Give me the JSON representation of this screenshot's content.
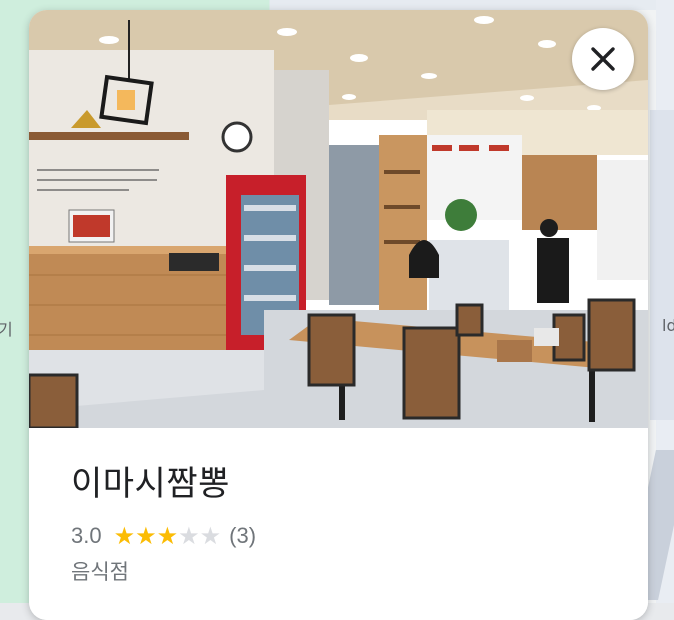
{
  "map": {
    "label_left": "기",
    "label_right": "ld"
  },
  "place": {
    "name": "이마시짬뽕",
    "rating": "3.0",
    "stars_filled": 3,
    "stars_total": 5,
    "review_count": "(3)",
    "category": "음식점",
    "photo_icon": "restaurant-interior-photo"
  },
  "close_button": {
    "icon": "close-icon"
  },
  "colors": {
    "star_filled": "#fbbc04",
    "star_empty": "#dadce0",
    "title_text": "#202124",
    "secondary_text": "#70757a"
  }
}
